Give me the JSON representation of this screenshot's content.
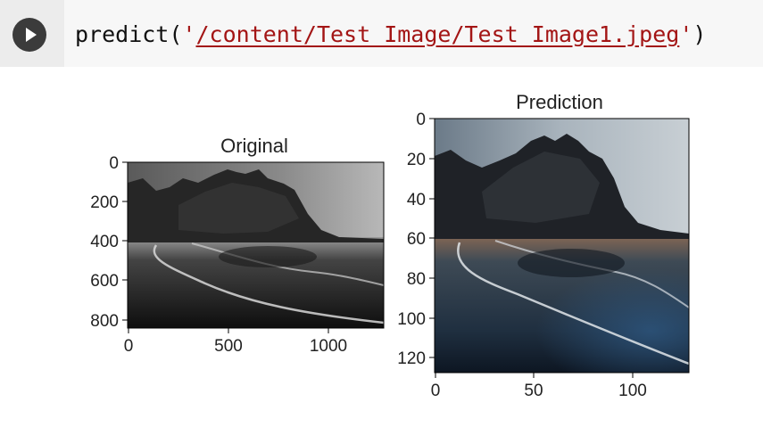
{
  "cell": {
    "code_prefix": "predict(",
    "quote_open": "'",
    "path": "/content/Test_Image/Test_Image1.jpeg",
    "quote_close": "'",
    "code_suffix": ")"
  },
  "plots": {
    "original": {
      "title": "Original",
      "x_ticks": [
        "0",
        "500",
        "1000"
      ],
      "y_ticks": [
        "0",
        "200",
        "400",
        "600",
        "800"
      ]
    },
    "prediction": {
      "title": "Prediction",
      "x_ticks": [
        "0",
        "50",
        "100"
      ],
      "y_ticks": [
        "0",
        "20",
        "40",
        "60",
        "80",
        "100",
        "120"
      ]
    }
  },
  "colors": {
    "run_button": "#3b3b3b",
    "gutter": "#ececec",
    "string": "#a31515"
  }
}
